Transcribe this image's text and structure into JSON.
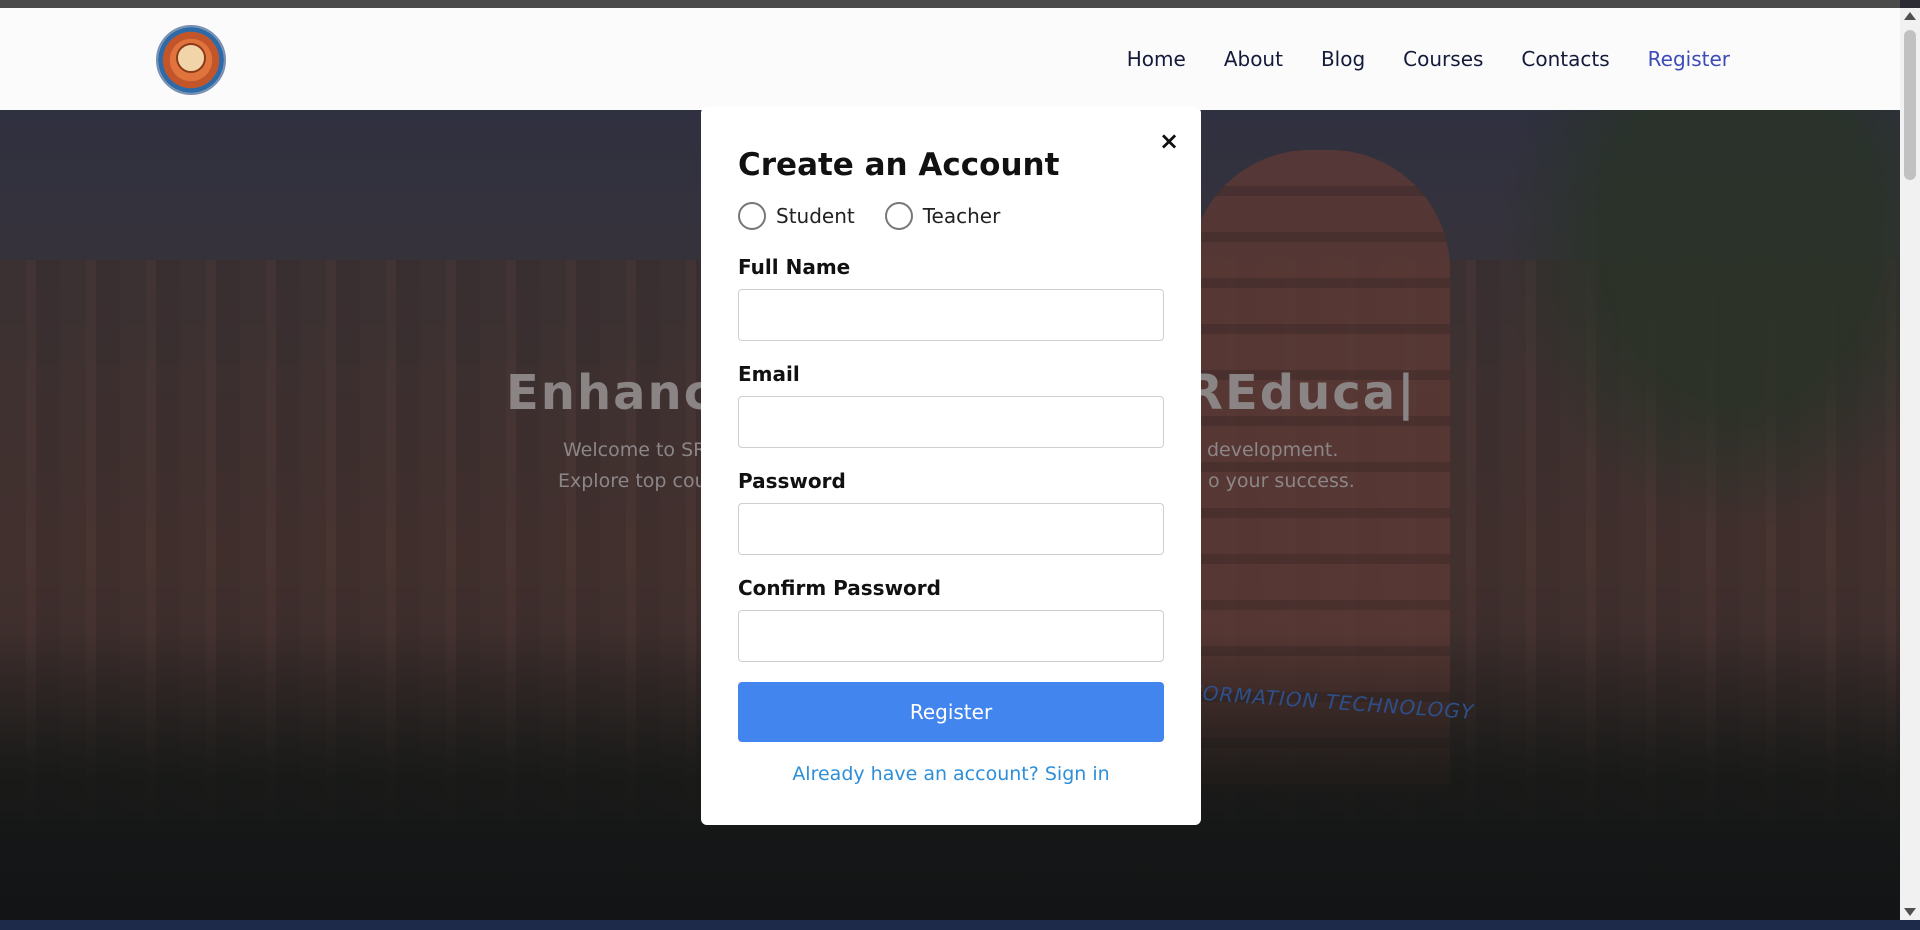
{
  "nav": {
    "items": [
      {
        "label": "Home"
      },
      {
        "label": "About"
      },
      {
        "label": "Blog"
      },
      {
        "label": "Courses"
      },
      {
        "label": "Contacts"
      },
      {
        "label": "Register"
      }
    ]
  },
  "hero": {
    "title_left": "Enhance",
    "title_right": "REduca|",
    "sub_line1_left": "Welcome to SR",
    "sub_line1_right": "development.",
    "sub_line2_left": "Explore top cou",
    "sub_line2_right": "o your success.",
    "building_sign": "FORMATION TECHNOLOGY"
  },
  "modal": {
    "title": "Create an Account",
    "close_label": "×",
    "roles": [
      {
        "label": "Student",
        "selected": false
      },
      {
        "label": "Teacher",
        "selected": false
      }
    ],
    "full_name_label": "Full Name",
    "full_name_value": "",
    "email_label": "Email",
    "email_value": "",
    "password_label": "Password",
    "password_value": "",
    "confirm_password_label": "Confirm Password",
    "confirm_password_value": "",
    "register_button": "Register",
    "signin_link": "Already have an account? Sign in"
  },
  "colors": {
    "accent": "#4285ee",
    "link": "#2e8fd8",
    "nav_active": "#3c4bb8"
  }
}
